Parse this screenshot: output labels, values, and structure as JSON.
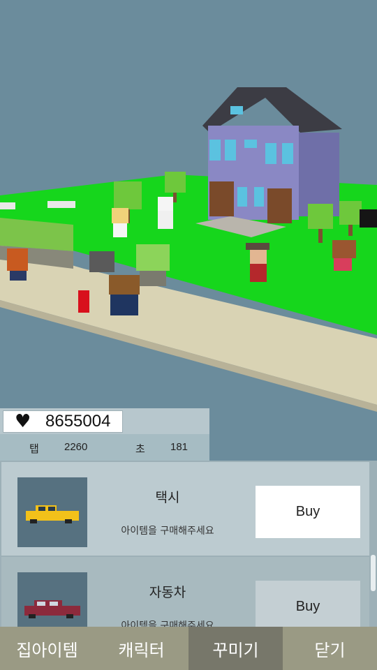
{
  "hud": {
    "heart_icon": "heart-icon",
    "hearts": "8655004",
    "tap_label": "탭",
    "tap_value": "2260",
    "sec_label": "초",
    "sec_value": "181"
  },
  "shop": {
    "items": [
      {
        "name": "택시",
        "desc": "아이템을 구매해주세요",
        "buy_label": "Buy",
        "icon": "taxi-icon",
        "color": "#e8c21e"
      },
      {
        "name": "자동차",
        "desc": "아이템을 구매해주세요",
        "buy_label": "Buy",
        "icon": "car-icon",
        "color": "#8c2a3c"
      }
    ]
  },
  "tabs": [
    {
      "label": "집아이템",
      "selected": false
    },
    {
      "label": "캐릭터",
      "selected": false
    },
    {
      "label": "꾸미기",
      "selected": true
    },
    {
      "label": "닫기",
      "selected": false
    }
  ]
}
